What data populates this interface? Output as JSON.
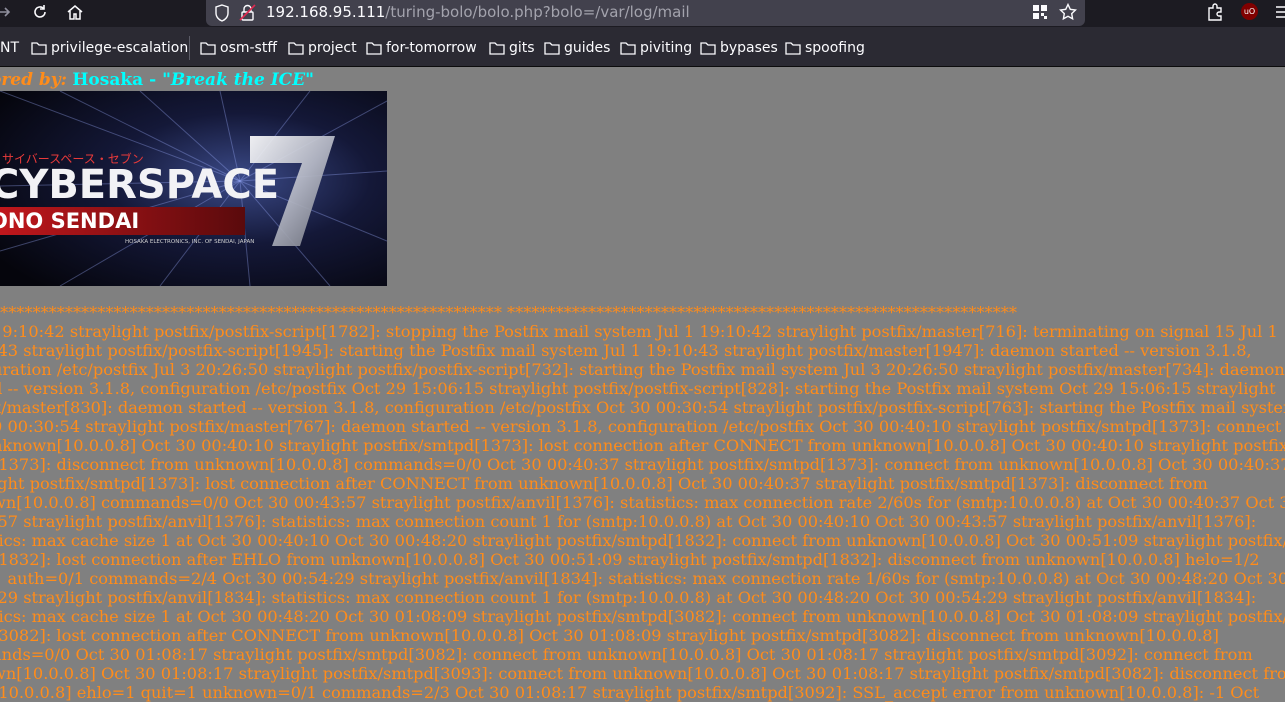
{
  "browser": {
    "url_host": "192.168.95.111",
    "url_path": "/turing-bolo/bolo.php?bolo=/var/log/mail",
    "bookmarks": [
      {
        "label": "NT",
        "folder": false
      },
      {
        "label": "privilege-escalation",
        "folder": true
      },
      {
        "label": "osm-stff",
        "folder": true
      },
      {
        "label": "project",
        "folder": true
      },
      {
        "label": "for-tomorrow",
        "folder": true
      },
      {
        "label": "gits",
        "folder": true
      },
      {
        "label": "guides",
        "folder": true
      },
      {
        "label": "piviting",
        "folder": true
      },
      {
        "label": "bypases",
        "folder": true
      },
      {
        "label": "spoofing",
        "folder": true
      }
    ],
    "extension_badge": "uO"
  },
  "page": {
    "sponsor_label": "ored by:",
    "sponsor_name": "Hosaka - ",
    "sponsor_tagline": "\"Break the ICE\"",
    "banner": {
      "jp_text": "サイバースペース・セブン",
      "title": "CYBERSPACE",
      "subtitle": "ONO SENDAI",
      "numeral": "7",
      "maker": "HOSAKA ELECTRONICS, INC. OF SENDAI, JAPAN"
    },
    "log_lines": [
      "*************************************************************** ***************************************************************",
      "19:10:42 straylight postfix/postfix-script[1782]: stopping the Postfix mail system Jul 1 19:10:42 straylight postfix/master[716]: terminating on signal 15 Jul 1",
      ":43 straylight postfix/postfix-script[1945]: starting the Postfix mail system Jul 1 19:10:43 straylight postfix/master[1947]: daemon started -- version 3.1.8,",
      "uration /etc/postfix Jul 3 20:26:50 straylight postfix/postfix-script[732]: starting the Postfix mail system Jul 3 20:26:50 straylight postfix/master[734]: daemon",
      "d -- version 3.1.8, configuration /etc/postfix Oct 29 15:06:15 straylight postfix/postfix-script[828]: starting the Postfix mail system Oct 29 15:06:15 straylight",
      "x/master[830]: daemon started -- version 3.1.8, configuration /etc/postfix Oct 30 00:30:54 straylight postfix/postfix-script[763]: starting the Postfix mail system",
      "0 00:30:54 straylight postfix/master[767]: daemon started -- version 3.1.8, configuration /etc/postfix Oct 30 00:40:10 straylight postfix/smtpd[1373]: connect",
      "nknown[10.0.0.8] Oct 30 00:40:10 straylight postfix/smtpd[1373]: lost connection after CONNECT from unknown[10.0.0.8] Oct 30 00:40:10 straylight postfix",
      "[1373]: disconnect from unknown[10.0.0.8] commands=0/0 Oct 30 00:40:37 straylight postfix/smtpd[1373]: connect from unknown[10.0.0.8] Oct 30 00:40:37",
      "ight postfix/smtpd[1373]: lost connection after CONNECT from unknown[10.0.0.8] Oct 30 00:40:37 straylight postfix/smtpd[1373]: disconnect from",
      "wn[10.0.0.8] commands=0/0 Oct 30 00:43:57 straylight postfix/anvil[1376]: statistics: max connection rate 2/60s for (smtp:10.0.0.8) at Oct 30 00:40:37 Oct 3",
      ":57 straylight postfix/anvil[1376]: statistics: max connection count 1 for (smtp:10.0.0.8) at Oct 30 00:40:10 Oct 30 00:43:57 straylight postfix/anvil[1376]:",
      "tics: max cache size 1 at Oct 30 00:40:10 Oct 30 00:48:20 straylight postfix/smtpd[1832]: connect from unknown[10.0.0.8] Oct 30 00:51:09 straylight postfix/",
      "[1832]: lost connection after EHLO from unknown[10.0.0.8] Oct 30 00:51:09 straylight postfix/smtpd[1832]: disconnect from unknown[10.0.0.8] helo=1/2",
      "1 auth=0/1 commands=2/4 Oct 30 00:54:29 straylight postfix/anvil[1834]: statistics: max connection rate 1/60s for (smtp:10.0.0.8) at Oct 30 00:48:20 Oct 30",
      ":29 straylight postfix/anvil[1834]: statistics: max connection count 1 for (smtp:10.0.0.8) at Oct 30 00:48:20 Oct 30 00:54:29 straylight postfix/anvil[1834]:",
      "tics: max cache size 1 at Oct 30 00:48:20 Oct 30 01:08:09 straylight postfix/smtpd[3082]: connect from unknown[10.0.0.8] Oct 30 01:08:09 straylight postfix/",
      "[3082]: lost connection after CONNECT from unknown[10.0.0.8] Oct 30 01:08:09 straylight postfix/smtpd[3082]: disconnect from unknown[10.0.0.8]",
      "ands=0/0 Oct 30 01:08:17 straylight postfix/smtpd[3082]: connect from unknown[10.0.0.8] Oct 30 01:08:17 straylight postfix/smtpd[3092]: connect from",
      "wn[10.0.0.8] Oct 30 01:08:17 straylight postfix/smtpd[3093]: connect from unknown[10.0.0.8] Oct 30 01:08:17 straylight postfix/smtpd[3082]: disconnect from",
      "[10.0.0.8] ehlo=1 quit=1 unknown=0/1 commands=2/3 Oct 30 01:08:17 straylight postfix/smtpd[3092]: SSL_accept error from unknown[10.0.0.8]: -1 Oct"
    ]
  }
}
